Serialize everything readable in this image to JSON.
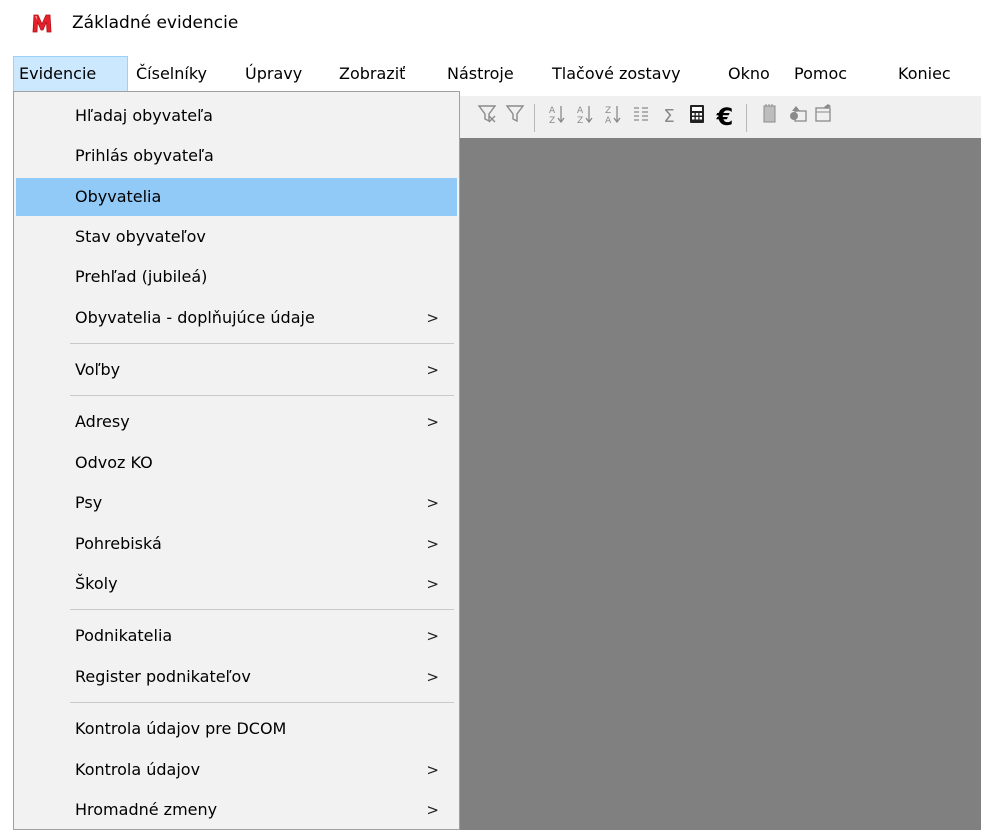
{
  "window": {
    "title": "Základné evidencie",
    "icon": "red-m-app-icon"
  },
  "menubar": {
    "items": [
      {
        "label": "Evidencie",
        "active": true
      },
      {
        "label": "Číselníky"
      },
      {
        "label": "Úpravy"
      },
      {
        "label": "Zobraziť"
      },
      {
        "label": "Nástroje"
      },
      {
        "label": "Tlačové zostavy"
      },
      {
        "label": "Okno"
      },
      {
        "label": "Pomoc"
      },
      {
        "label": "Koniec"
      }
    ]
  },
  "toolbar": {
    "icons": [
      "filter-clear-icon",
      "filter-icon",
      "sort-az-icon",
      "sort-ascending-icon",
      "sort-descending-icon",
      "columns-icon",
      "sum-icon",
      "calculator-icon",
      "euro-icon",
      "document-icon",
      "shapes-icon",
      "properties-icon"
    ],
    "glyphs": {
      "sum": "Σ",
      "euro": "€"
    }
  },
  "dropdown": {
    "items": [
      {
        "label": "Hľadaj obyvateľa"
      },
      {
        "label": "Prihlás obyvateľa"
      },
      {
        "label": "Obyvatelia",
        "highlighted": true
      },
      {
        "label": "Stav obyvateľov"
      },
      {
        "label": "Prehľad (jubileá)"
      },
      {
        "label": "Obyvatelia - doplňujúce údaje",
        "submenu": true
      },
      {
        "label": "Voľby",
        "submenu": true
      },
      {
        "label": "Adresy",
        "submenu": true
      },
      {
        "label": "Odvoz KO"
      },
      {
        "label": "Psy",
        "submenu": true
      },
      {
        "label": "Pohrebiská",
        "submenu": true
      },
      {
        "label": "Školy",
        "submenu": true
      },
      {
        "label": "Podnikatelia",
        "submenu": true
      },
      {
        "label": "Register podnikateľov",
        "submenu": true
      },
      {
        "label": "Kontrola údajov pre DCOM"
      },
      {
        "label": "Kontrola údajov",
        "submenu": true
      },
      {
        "label": "Hromadné zmeny",
        "submenu": true
      }
    ],
    "submenu_arrow": ">"
  },
  "colors": {
    "highlight": "#91c9f7",
    "menu_active": "#cce8ff",
    "workspace": "#808080",
    "menu_bg": "#f2f2f2",
    "app_icon": "#e8202a"
  }
}
